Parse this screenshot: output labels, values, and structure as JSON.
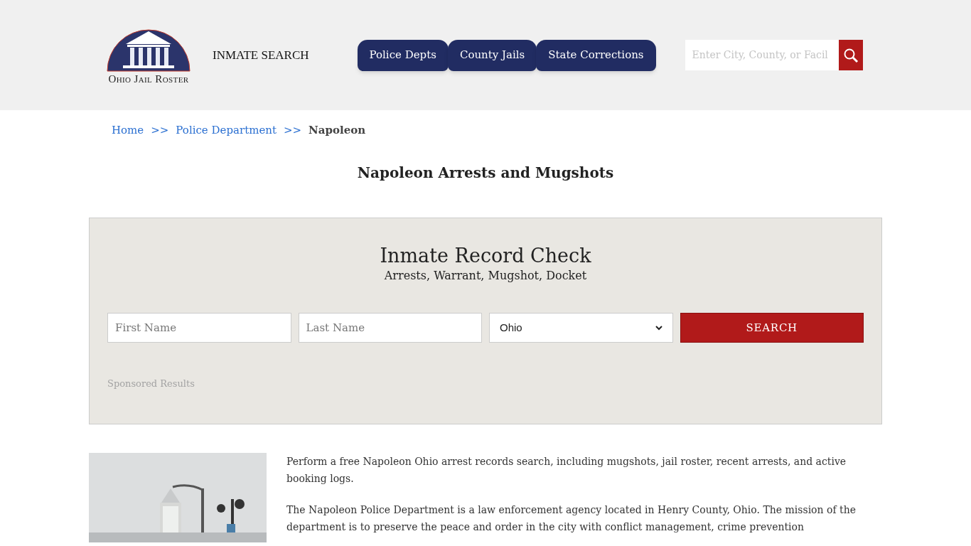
{
  "header": {
    "logo_text": "Ohio Jail Roster",
    "nav_link": "INMATE SEARCH",
    "tabs": [
      {
        "label": "Police Depts",
        "selected": false
      },
      {
        "label": "County Jails",
        "selected": false
      },
      {
        "label": "State Corrections",
        "selected": false
      }
    ],
    "search": {
      "placeholder": "Enter City, County, or Facil"
    }
  },
  "breadcrumb": [
    {
      "label": "Home",
      "kind": "link"
    },
    {
      "label": ">>",
      "kind": "separator"
    },
    {
      "label": "Police Department",
      "kind": "link"
    },
    {
      "label": ">>",
      "kind": "separator"
    },
    {
      "label": "Napoleon",
      "kind": "current"
    }
  ],
  "title": "Napoleon Arrests and Mugshots",
  "record_check": {
    "title": "Inmate Record Check",
    "subtitle": "Arrests, Warrant, Mugshot, Docket",
    "first_name": {
      "placeholder": "First Name"
    },
    "last_name": {
      "placeholder": "Last Name"
    },
    "state": {
      "value": "Ohio"
    },
    "button": "SEARCH",
    "sponsored": "Sponsored Results"
  },
  "content": {
    "image": {
      "kind": "picture"
    },
    "paragraphs": [
      "Perform a free Napoleon Ohio arrest records search, including mugshots, jail roster, recent arrests, and active booking logs.",
      "The Napoleon Police Department is a law enforcement agency located in Henry County, Ohio. The mission of the department is to preserve the peace and order in the city with conflict management, crime prevention"
    ]
  }
}
